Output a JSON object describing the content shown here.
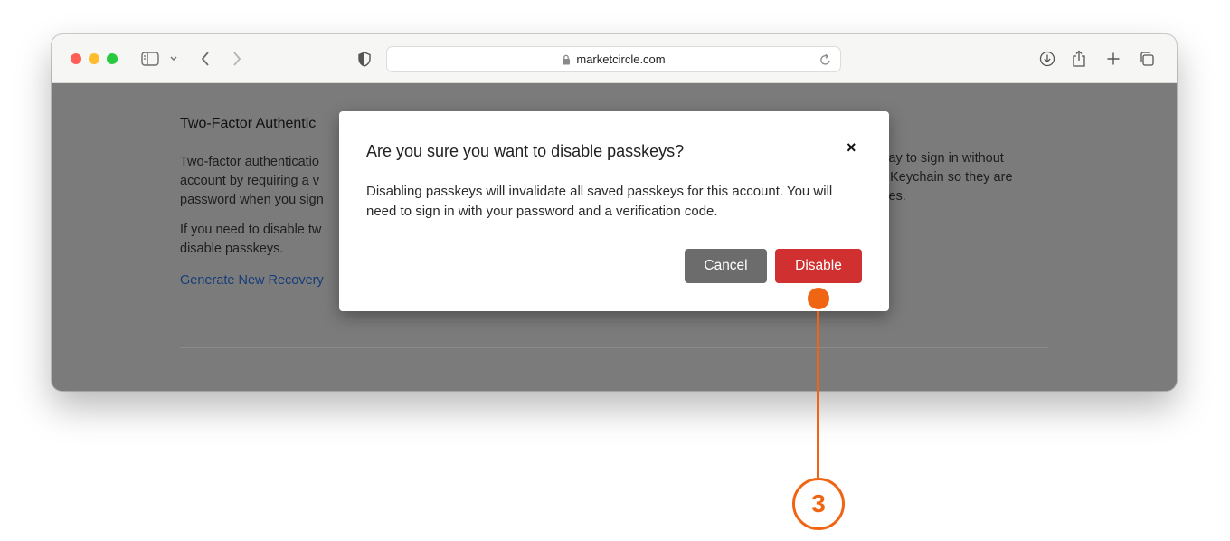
{
  "browser": {
    "url": "marketcircle.com",
    "icons": [
      "sidebar-icon",
      "chevron-down-icon",
      "back-icon",
      "forward-icon",
      "shield-icon",
      "lock-icon",
      "reload-icon",
      "download-icon",
      "share-icon",
      "new-tab-icon",
      "tabs-overview-icon"
    ]
  },
  "page": {
    "heading": "Two-Factor Authentic",
    "para1_line1": "Two-factor authenticatio",
    "para1_line2": "account by requiring a v",
    "para1_line3": "password when you sign",
    "para2_line1": "If you need to disable tw",
    "para2_line2": "disable passkeys.",
    "link": "Generate New Recovery",
    "right_line1": "way to sign in without",
    "right_line2": "d Keychain so they are",
    "right_line3": "ices."
  },
  "modal": {
    "title": "Are you sure you want to disable passkeys?",
    "close": "×",
    "body": "Disabling passkeys will invalidate all saved passkeys for this account. You will need to sign in with your password and a verification code.",
    "cancel_label": "Cancel",
    "disable_label": "Disable"
  },
  "annotation": {
    "step": "3",
    "color": "#f06514"
  },
  "colors": {
    "disable_button": "#d0302f",
    "cancel_button": "#6c6c6c",
    "link": "#163d7a"
  }
}
